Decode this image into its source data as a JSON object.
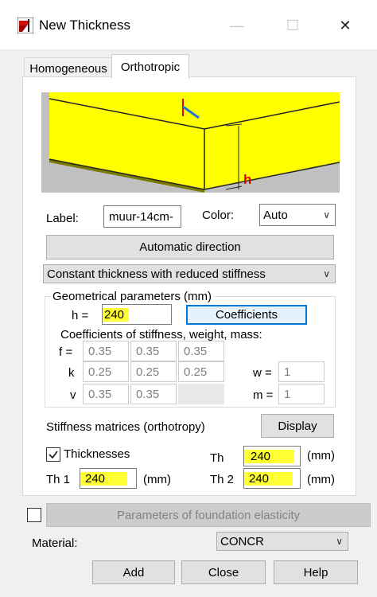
{
  "window": {
    "title": "New Thickness"
  },
  "tabs": [
    {
      "label": "Homogeneous"
    },
    {
      "label": "Orthotropic"
    }
  ],
  "illustration": {
    "h_label": "h"
  },
  "label_field": {
    "label": "Label:",
    "value": "muur-14cm-"
  },
  "color_field": {
    "label": "Color:",
    "value": "Auto"
  },
  "automatic_direction_label": "Automatic direction",
  "thickness_type": {
    "value": "Constant thickness with reduced stiffness"
  },
  "geometric": {
    "title": "Geometrical parameters (mm)",
    "h_label": "h  =",
    "h_value": "240",
    "coefficients_label": "Coefficients"
  },
  "coef": {
    "title": "Coefficients of stiffness, weight, mass:",
    "f_label": "f =",
    "k_label": "k",
    "v_label": "v",
    "f_values": [
      "0.35",
      "0.35",
      "0.35"
    ],
    "k_values": [
      "0.25",
      "0.25",
      "0.25"
    ],
    "v_values": [
      "0.35",
      "0.35"
    ],
    "w_label": "w =",
    "w_value": "1",
    "m_label": "m =",
    "m_value": "1"
  },
  "stiffness": {
    "label": "Stiffness matrices (orthotropy)",
    "display_label": "Display"
  },
  "thicknesses": {
    "checkbox_label": "Thicknesses",
    "checked": true,
    "th_label": "Th",
    "th_value": "240",
    "th_unit": "(mm)",
    "th1_label": "Th 1",
    "th1_value": "240",
    "th1_unit": "(mm)",
    "th2_label": "Th 2",
    "th2_value": "240",
    "th2_unit": "(mm)"
  },
  "foundation": {
    "label": "Parameters of foundation elasticity"
  },
  "material": {
    "label": "Material:",
    "value": "CONCR"
  },
  "buttons": {
    "add": "Add",
    "close": "Close",
    "help": "Help"
  },
  "colors": {
    "highlight": "#ffff33",
    "slab_yellow": "#ffff00",
    "accent": "#0078d7"
  }
}
